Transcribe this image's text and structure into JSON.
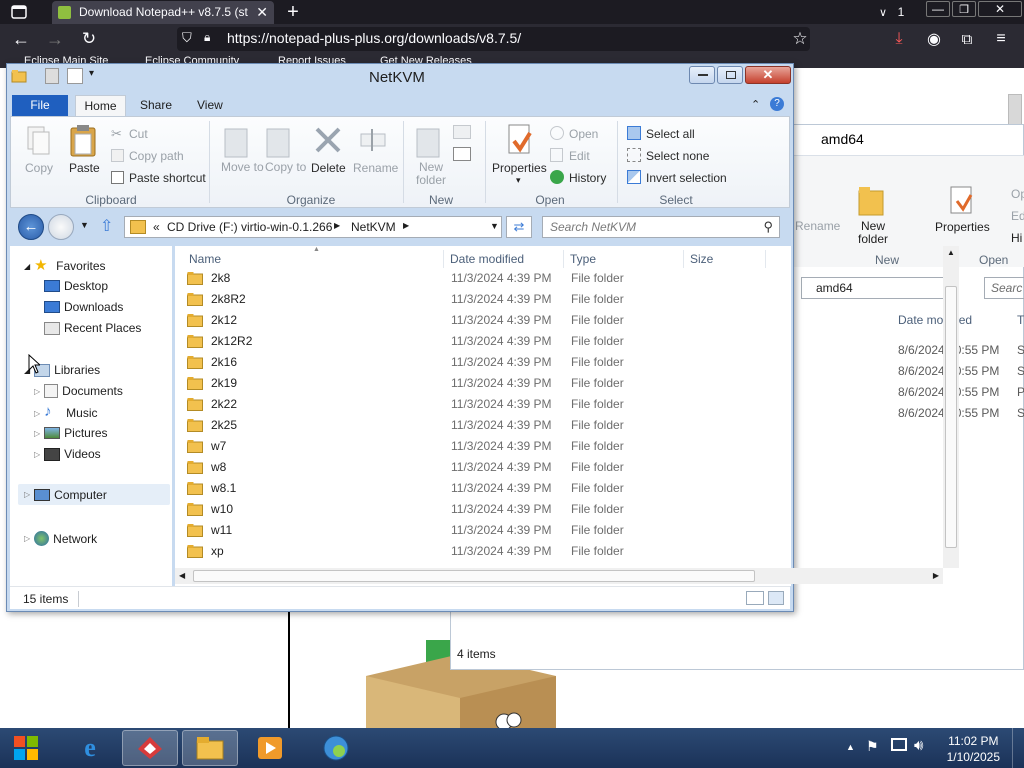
{
  "browser": {
    "tab_title": "Download Notepad++ v8.7.5 (st",
    "tab_count": "1",
    "url": "https://notepad-plus-plus.org/downloads/v8.7.5/",
    "bookmarks": [
      "Eclipse Main Site",
      "Eclipse Community",
      "Report Issues",
      "Get New Releases"
    ]
  },
  "bg_window": {
    "title": "amd64",
    "ribbon_labels": [
      "Rename",
      "New folder",
      "Properties",
      "Op",
      "Ed",
      "Hi"
    ],
    "group_labels": [
      "New",
      "Open"
    ],
    "address": "amd64",
    "search_placeholder": "Searc",
    "col_date": "Date modified",
    "col_t": "T",
    "rows": [
      {
        "date": "8/6/2024 10:55 PM",
        "type": "S"
      },
      {
        "date": "8/6/2024 10:55 PM",
        "type": "S"
      },
      {
        "date": "8/6/2024 10:55 PM",
        "type": "P"
      },
      {
        "date": "8/6/2024 10:55 PM",
        "type": "S"
      }
    ],
    "status": "4 items"
  },
  "explorer": {
    "title": "NetKVM",
    "tabs": {
      "file": "File",
      "home": "Home",
      "share": "Share",
      "view": "View"
    },
    "ribbon": {
      "copy": "Copy",
      "paste": "Paste",
      "cut": "Cut",
      "copy_path": "Copy path",
      "paste_shortcut": "Paste shortcut",
      "move_to": "Move to",
      "copy_to": "Copy to",
      "delete": "Delete",
      "rename": "Rename",
      "new_folder": "New folder",
      "properties": "Properties",
      "open": "Open",
      "edit": "Edit",
      "history": "History",
      "select_all": "Select all",
      "select_none": "Select none",
      "invert_selection": "Invert selection"
    },
    "groups": {
      "clipboard": "Clipboard",
      "organize": "Organize",
      "new": "New",
      "open": "Open",
      "select": "Select"
    },
    "address": {
      "prefix": "«",
      "drive": "CD Drive (F:) virtio-win-0.1.266",
      "folder": "NetKVM"
    },
    "search_placeholder": "Search NetKVM",
    "nav": {
      "favorites": "Favorites",
      "desktop": "Desktop",
      "downloads": "Downloads",
      "recent": "Recent Places",
      "libraries": "Libraries",
      "documents": "Documents",
      "music": "Music",
      "pictures": "Pictures",
      "videos": "Videos",
      "computer": "Computer",
      "network": "Network"
    },
    "columns": {
      "name": "Name",
      "date": "Date modified",
      "type": "Type",
      "size": "Size"
    },
    "files": [
      {
        "name": "2k8",
        "date": "11/3/2024 4:39 PM",
        "type": "File folder"
      },
      {
        "name": "2k8R2",
        "date": "11/3/2024 4:39 PM",
        "type": "File folder"
      },
      {
        "name": "2k12",
        "date": "11/3/2024 4:39 PM",
        "type": "File folder"
      },
      {
        "name": "2k12R2",
        "date": "11/3/2024 4:39 PM",
        "type": "File folder"
      },
      {
        "name": "2k16",
        "date": "11/3/2024 4:39 PM",
        "type": "File folder"
      },
      {
        "name": "2k19",
        "date": "11/3/2024 4:39 PM",
        "type": "File folder"
      },
      {
        "name": "2k22",
        "date": "11/3/2024 4:39 PM",
        "type": "File folder"
      },
      {
        "name": "2k25",
        "date": "11/3/2024 4:39 PM",
        "type": "File folder"
      },
      {
        "name": "w7",
        "date": "11/3/2024 4:39 PM",
        "type": "File folder"
      },
      {
        "name": "w8",
        "date": "11/3/2024 4:39 PM",
        "type": "File folder"
      },
      {
        "name": "w8.1",
        "date": "11/3/2024 4:39 PM",
        "type": "File folder"
      },
      {
        "name": "w10",
        "date": "11/3/2024 4:39 PM",
        "type": "File folder"
      },
      {
        "name": "w11",
        "date": "11/3/2024 4:39 PM",
        "type": "File folder"
      },
      {
        "name": "xp",
        "date": "11/3/2024 4:39 PM",
        "type": "File folder"
      }
    ],
    "status": "15 items"
  },
  "taskbar": {
    "time": "11:02 PM",
    "date": "1/10/2025"
  }
}
